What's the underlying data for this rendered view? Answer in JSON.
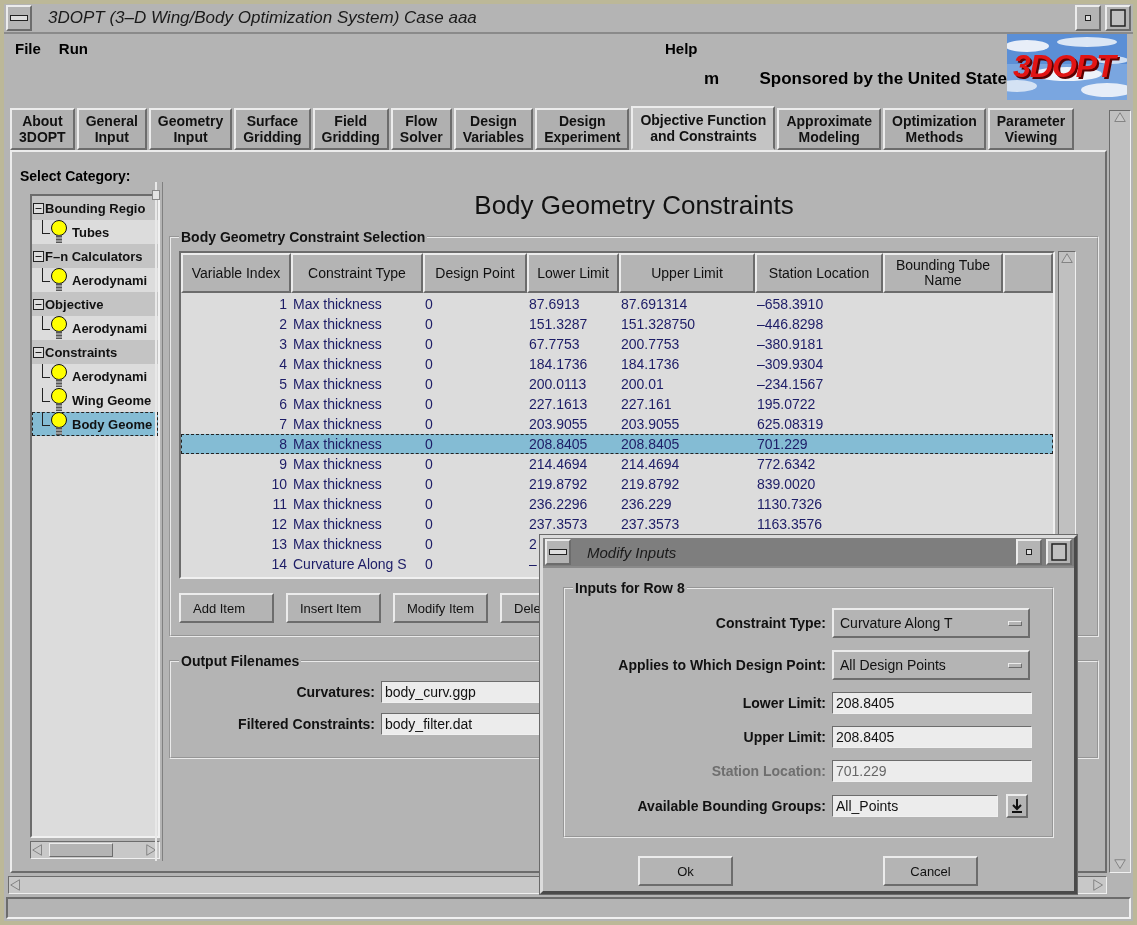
{
  "window": {
    "title": "3DOPT (3–D Wing/Body Optimization System) Case aaa"
  },
  "menus": [
    "File",
    "Run"
  ],
  "help_menu": "Help",
  "banner": {
    "prefix": "m",
    "text": "Sponsored by the United State"
  },
  "logo": {
    "text": "3DOPT"
  },
  "tabs": [
    {
      "label": "About\n3DOPT",
      "selected": false
    },
    {
      "label": "General\nInput",
      "selected": false
    },
    {
      "label": "Geometry\nInput",
      "selected": false
    },
    {
      "label": "Surface\nGridding",
      "selected": false
    },
    {
      "label": "Field\nGridding",
      "selected": false
    },
    {
      "label": "Flow\nSolver",
      "selected": false
    },
    {
      "label": "Design\nVariables",
      "selected": false
    },
    {
      "label": "Design\nExperiment",
      "selected": false
    },
    {
      "label": "Objective Function\nand Constraints",
      "selected": true
    },
    {
      "label": "Approximate\nModeling",
      "selected": false
    },
    {
      "label": "Optimization\nMethods",
      "selected": false
    },
    {
      "label": "Parameter\nViewing",
      "selected": false
    }
  ],
  "category_label": "Select Category:",
  "tree": [
    {
      "label": "Bounding Regio",
      "expanded": true,
      "children": [
        {
          "label": "Tubes",
          "selected": false
        }
      ]
    },
    {
      "label": "F–n Calculators",
      "expanded": true,
      "children": [
        {
          "label": "Aerodynami",
          "selected": false
        }
      ]
    },
    {
      "label": "Objective",
      "expanded": true,
      "children": [
        {
          "label": "Aerodynami",
          "selected": false
        }
      ]
    },
    {
      "label": "Constraints",
      "expanded": true,
      "children": [
        {
          "label": "Aerodynami",
          "selected": false
        },
        {
          "label": "Wing Geome",
          "selected": false
        },
        {
          "label": "Body Geome",
          "selected": true
        }
      ]
    }
  ],
  "heading": "Body Geometry Constraints",
  "constraint_group": {
    "title": "Body Geometry Constraint Selection",
    "columns": [
      "Variable Index",
      "Constraint Type",
      "Design Point",
      "Lower Limit",
      "Upper Limit",
      "Station Location",
      "Bounding Tube\nName"
    ],
    "rows": [
      {
        "cells": [
          "1",
          "Max thickness",
          "0",
          "87.6913",
          "87.691314",
          "–658.3910"
        ],
        "selected": false
      },
      {
        "cells": [
          "2",
          "Max thickness",
          "0",
          "151.3287",
          "151.328750",
          "–446.8298"
        ],
        "selected": false
      },
      {
        "cells": [
          "3",
          "Max thickness",
          "0",
          "67.7753",
          "200.7753",
          "–380.9181"
        ],
        "selected": false
      },
      {
        "cells": [
          "4",
          "Max thickness",
          "0",
          "184.1736",
          "184.1736",
          "–309.9304"
        ],
        "selected": false
      },
      {
        "cells": [
          "5",
          "Max thickness",
          "0",
          "200.0113",
          "200.01",
          "–234.1567"
        ],
        "selected": false
      },
      {
        "cells": [
          "6",
          "Max thickness",
          "0",
          "227.1613",
          "227.161",
          "195.0722"
        ],
        "selected": false
      },
      {
        "cells": [
          "7",
          "Max thickness",
          "0",
          "203.9055",
          "203.9055",
          "625.08319"
        ],
        "selected": false
      },
      {
        "cells": [
          "8",
          "Max thickness",
          "0",
          "208.8405",
          "208.8405",
          "701.229"
        ],
        "selected": true
      },
      {
        "cells": [
          "9",
          "Max thickness",
          "0",
          "214.4694",
          "214.4694",
          "772.6342"
        ],
        "selected": false
      },
      {
        "cells": [
          "10",
          "Max thickness",
          "0",
          "219.8792",
          "219.8792",
          "839.0020"
        ],
        "selected": false
      },
      {
        "cells": [
          "11",
          "Max thickness",
          "0",
          "236.2296",
          "236.229",
          "1130.7326"
        ],
        "selected": false
      },
      {
        "cells": [
          "12",
          "Max thickness",
          "0",
          "237.3573",
          "237.3573",
          "1163.3576"
        ],
        "selected": false
      },
      {
        "cells": [
          "13",
          "Max thickness",
          "0",
          "2"
        ],
        "selected": false
      },
      {
        "cells": [
          "14",
          "Curvature Along S",
          "0",
          "–"
        ],
        "selected": false
      }
    ]
  },
  "buttons": [
    "Add Item",
    "Insert Item",
    "Modify Item",
    "Dele"
  ],
  "output_group": {
    "title": "Output Filenames",
    "fields": [
      {
        "label": "Curvatures:",
        "value": "body_curv.ggp"
      },
      {
        "label": "Filtered Constraints:",
        "value": "body_filter.dat"
      }
    ]
  },
  "dialog": {
    "title": "Modify Inputs",
    "group_title": "Inputs for Row 8",
    "fields": [
      {
        "kind": "option",
        "label": "Constraint Type:",
        "value": "Curvature Along T",
        "disabled": false
      },
      {
        "kind": "option",
        "label": "Applies to Which Design Point:",
        "value": "All Design Points",
        "disabled": false
      },
      {
        "kind": "text",
        "label": "Lower Limit:",
        "value": "208.8405",
        "disabled": false
      },
      {
        "kind": "text",
        "label": "Upper Limit:",
        "value": "208.8405",
        "disabled": false
      },
      {
        "kind": "text",
        "label": "Station Location:",
        "value": "701.229",
        "disabled": true
      },
      {
        "kind": "combo",
        "label": "Available Bounding Groups:",
        "value": "All_Points",
        "disabled": false
      }
    ],
    "buttons": [
      "Ok",
      "Cancel"
    ]
  }
}
